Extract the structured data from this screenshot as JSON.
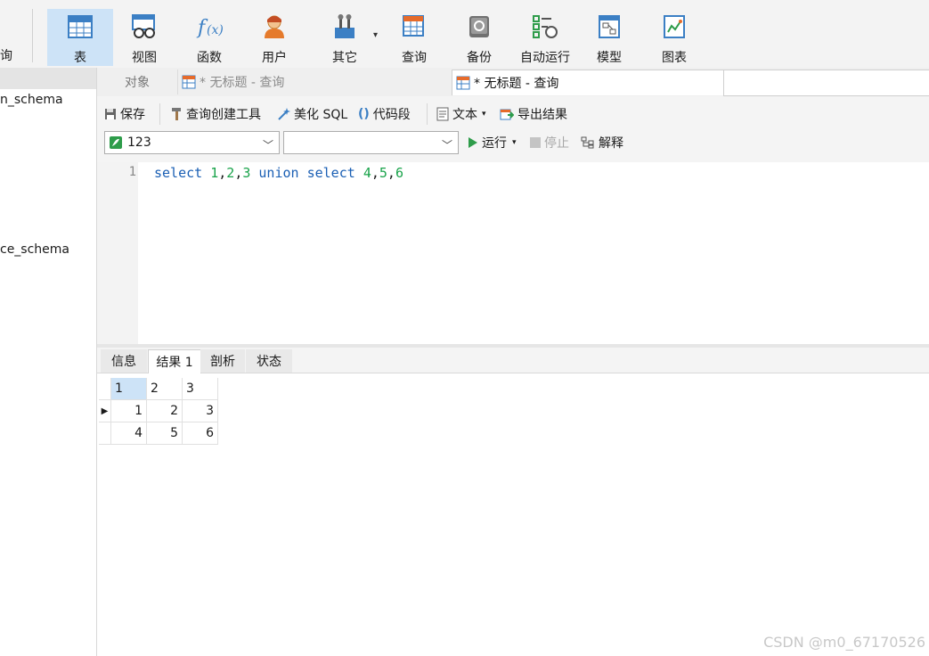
{
  "toolbar": {
    "partial_label": "询",
    "buttons": [
      {
        "label": "表",
        "icon": "table-icon"
      },
      {
        "label": "视图",
        "icon": "view-icon"
      },
      {
        "label": "函数",
        "icon": "function-icon"
      },
      {
        "label": "用户",
        "icon": "user-icon"
      },
      {
        "label": "其它",
        "icon": "tools-icon"
      },
      {
        "label": "查询",
        "icon": "query-icon"
      },
      {
        "label": "备份",
        "icon": "backup-icon"
      },
      {
        "label": "自动运行",
        "icon": "automation-icon"
      },
      {
        "label": "模型",
        "icon": "model-icon"
      },
      {
        "label": "图表",
        "icon": "chart-icon"
      }
    ]
  },
  "sidebar": {
    "items": [
      {
        "label": "n_schema"
      },
      {
        "label": "ce_schema"
      }
    ]
  },
  "tabs": {
    "objects": "对象",
    "untitled1": "* 无标题 - 查询",
    "untitled2": "* 无标题 - 查询"
  },
  "query_toolbar": {
    "save": "保存",
    "builder": "查询创建工具",
    "beautify": "美化 SQL",
    "snippet": "代码段",
    "text": "文本",
    "export": "导出结果",
    "connection": "123",
    "database": "",
    "run": "运行",
    "stop": "停止",
    "explain": "解释"
  },
  "editor": {
    "line_number": "1",
    "tokens": [
      {
        "t": "select ",
        "c": "kw"
      },
      {
        "t": "1",
        "c": "num"
      },
      {
        "t": ",",
        "c": ""
      },
      {
        "t": "2",
        "c": "num"
      },
      {
        "t": ",",
        "c": ""
      },
      {
        "t": "3",
        "c": "num"
      },
      {
        "t": " union select ",
        "c": "kw"
      },
      {
        "t": "4",
        "c": "num"
      },
      {
        "t": ",",
        "c": ""
      },
      {
        "t": "5",
        "c": "num"
      },
      {
        "t": ",",
        "c": ""
      },
      {
        "t": "6",
        "c": "num"
      }
    ]
  },
  "result_tabs": [
    "信息",
    "结果 1",
    "剖析",
    "状态"
  ],
  "result": {
    "columns": [
      "1",
      "2",
      "3"
    ],
    "rows": [
      [
        "1",
        "2",
        "3"
      ],
      [
        "4",
        "5",
        "6"
      ]
    ]
  },
  "watermark": "CSDN @m0_67170526"
}
